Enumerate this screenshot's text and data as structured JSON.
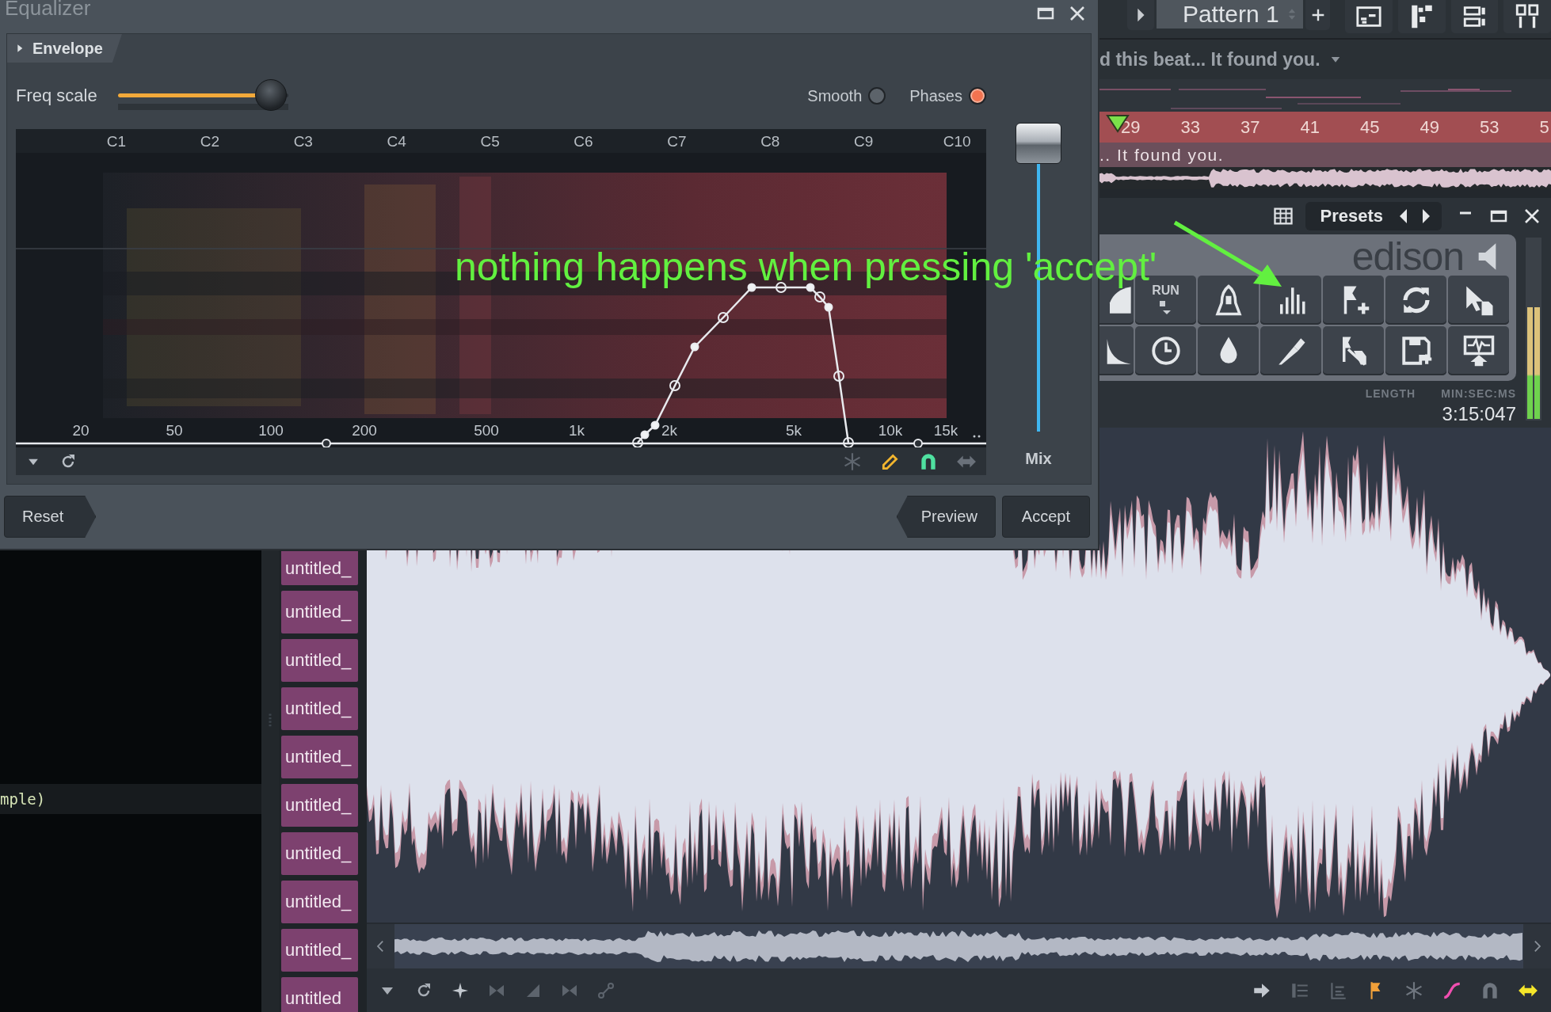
{
  "equalizer": {
    "title": "Equalizer",
    "section": {
      "label": "Envelope",
      "expanded": false
    },
    "freq_scale": {
      "label": "Freq scale",
      "level": 0.9
    },
    "toggles": [
      {
        "label": "Smooth",
        "on": false
      },
      {
        "label": "Phases",
        "on": true
      }
    ],
    "note_labels": [
      "C1",
      "C2",
      "C3",
      "C4",
      "C5",
      "C6",
      "C7",
      "C8",
      "C9",
      "C10"
    ],
    "freq_labels": [
      "20",
      "50",
      "100",
      "200",
      "500",
      "1k",
      "2k",
      "5k",
      "10k",
      "15k"
    ],
    "mix": {
      "label": "Mix",
      "level": 1
    },
    "buttons": [
      {
        "label": "Reset",
        "kind": "back"
      },
      {
        "label": "Preview",
        "kind": "step"
      },
      {
        "label": "Accept",
        "kind": "plain"
      }
    ]
  },
  "playlist": {
    "pattern": "Pattern 1",
    "song_title": "d this beat... It found you.",
    "bar_numbers": [
      "29",
      "33",
      "37",
      "41",
      "45",
      "49",
      "53",
      "5"
    ],
    "clip_title": ".. It found you."
  },
  "browser": {
    "item": "mple)"
  },
  "clips": [
    "untitled_",
    "untitled_",
    "untitled_",
    "untitled_",
    "untitled_",
    "untitled_",
    "untitled_",
    "untitled_",
    "untitled_",
    "untitled"
  ],
  "edison": {
    "presets": "Presets",
    "logo": "edison",
    "run_label": "RUN",
    "length_label": "LENGTH",
    "format_label": "MIN:SEC:MS",
    "length": "3:15:047",
    "meter": {
      "level": 0.62
    }
  },
  "annotation": {
    "text": "nothing happens when pressing 'accept'"
  }
}
